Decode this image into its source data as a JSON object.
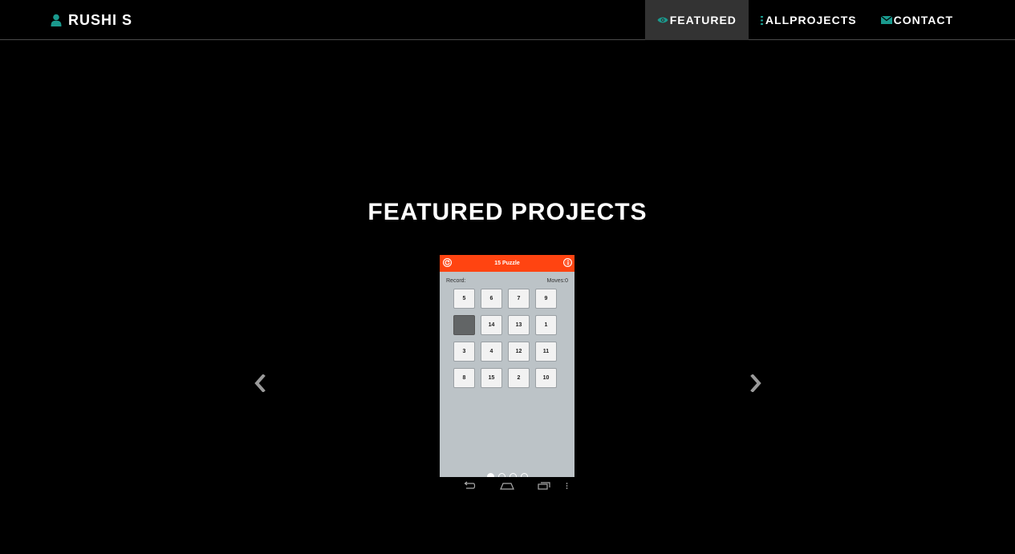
{
  "brand": {
    "name": "RUSHI S",
    "icon": "user-icon"
  },
  "nav": [
    {
      "label": "FEATURED",
      "icon": "eye-icon",
      "active": true
    },
    {
      "label": "ALLPROJECTS",
      "icon": "list-icon",
      "active": false
    },
    {
      "label": "CONTACT",
      "icon": "envelope-icon",
      "active": false
    }
  ],
  "section": {
    "title": "FEATURED PROJECTS"
  },
  "carousel": {
    "prev_icon": "chevron-left-icon",
    "next_icon": "chevron-right-icon",
    "slide_count": 4,
    "active_slide": 1
  },
  "app": {
    "title": "15 Puzzle",
    "record_label": "Record:",
    "moves_label": "Moves:0",
    "tiles": [
      "5",
      "6",
      "7",
      "9",
      "",
      "14",
      "13",
      "1",
      "3",
      "4",
      "12",
      "11",
      "8",
      "15",
      "2",
      "10"
    ],
    "app_bar_color": "#ff4411",
    "system_bar_icons": [
      "back-icon",
      "home-icon",
      "recent-apps-icon",
      "overflow-menu-icon"
    ]
  },
  "colors": {
    "accent": "#1a9a8e",
    "background": "#000000",
    "nav_active_bg": "#333333"
  }
}
